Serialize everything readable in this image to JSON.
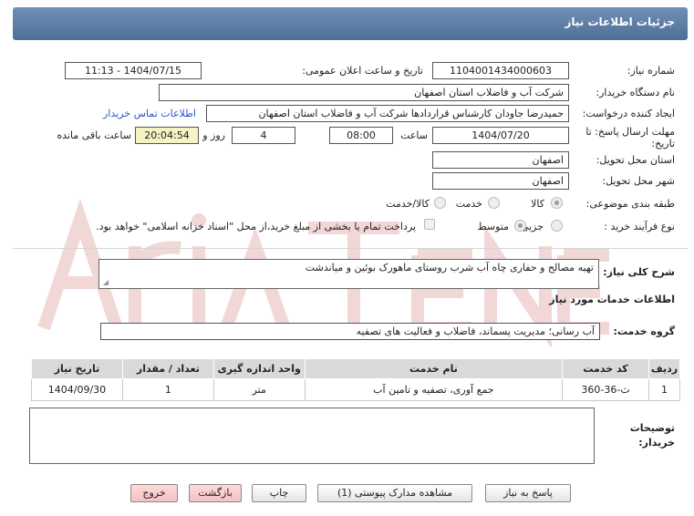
{
  "header": {
    "title": "جزئیات اطلاعات نیاز"
  },
  "fields": {
    "need_number_label": "شماره نیاز:",
    "need_number": "1104001434000603",
    "announce_label": "تاریخ و ساعت اعلان عمومی:",
    "announce_value": "1404/07/15 - 11:13",
    "buyer_org_label": "نام دستگاه خریدار:",
    "buyer_org": "شرکت آب و فاضلاب استان اصفهان",
    "creator_label": "ایجاد کننده درخواست:",
    "creator": "حمیدرضا جاودان کارشناس قراردادها شرکت آب و فاضلاب استان اصفهان",
    "contact_link": "اطلاعات تماس خریدار",
    "deadline_label_1": "مهلت ارسال پاسخ: تا",
    "deadline_label_2": "تاریخ:",
    "deadline_date": "1404/07/20",
    "time_label": "ساعت",
    "deadline_time": "08:00",
    "days_value": "4",
    "days_label": "روز و",
    "remaining_time": "20:04:54",
    "remaining_label": "ساعت باقی مانده",
    "province_label": "استان محل تحویل:",
    "province": "اصفهان",
    "city_label": "شهر محل تحویل:",
    "city": "اصفهان",
    "category_label": "طبقه بندی موضوعی:",
    "category_options": [
      "کالا",
      "خدمت",
      "کالا/خدمت"
    ],
    "process_label": "نوع فرآیند خرید :",
    "process_options": [
      "جزیی",
      "متوسط"
    ],
    "payment_note": "پرداخت تمام یا بخشی از مبلغ خرید،از محل \"اسناد خزانه اسلامی\" خواهد بود."
  },
  "summary": {
    "label": "شرح کلی نیاز:",
    "text": "تهیه مصالح و حفاری چاه آب شرب روستای ماهورک بوئین و میاندشت"
  },
  "services_title": "اطلاعات خدمات مورد نیاز",
  "service_group": {
    "label": "گروه خدمت:",
    "value": "آب رسانی؛ مدیریت پسماند، فاضلاب و فعالیت های تصفیه"
  },
  "table": {
    "headers": [
      "ردیف",
      "کد خدمت",
      "نام خدمت",
      "واحد اندازه گیری",
      "تعداد / مقدار",
      "تاریخ نیاز"
    ],
    "rows": [
      [
        "1",
        "ث-36-360",
        "جمع آوری، تصفیه و تامین آب",
        "متر",
        "1",
        "1404/09/30"
      ]
    ]
  },
  "buyer_notes": {
    "label_1": "توضیحات",
    "label_2": "خریدار:"
  },
  "buttons": {
    "reply": "پاسخ به نیاز",
    "attachments": "مشاهده مدارک پیوستی (1)",
    "print": "چاپ",
    "back": "بازگشت",
    "exit": "خروج"
  },
  "colors": {
    "header": "#5b7ba3",
    "link": "#2a55c6",
    "remaining_bg": "#f5f2c3",
    "table_header": "#d9d9d9"
  }
}
